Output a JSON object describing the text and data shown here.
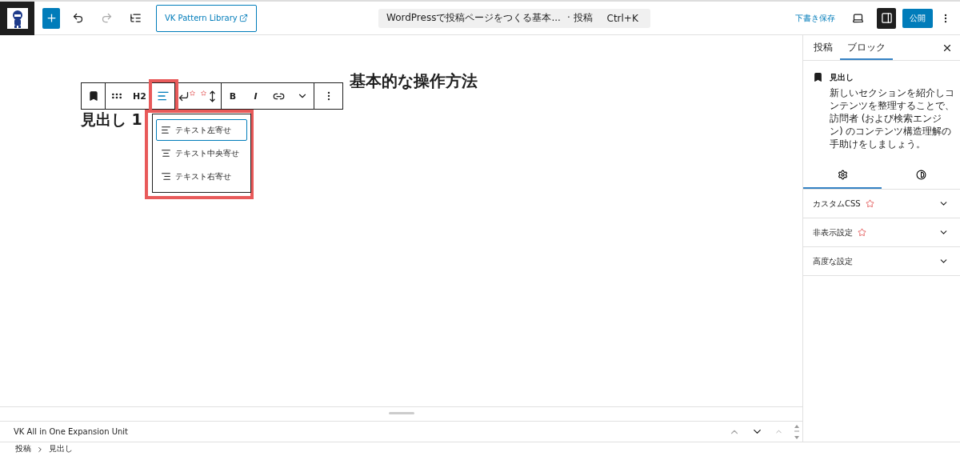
{
  "header": {
    "pattern_button": "VK Pattern Library",
    "command_bar": {
      "title": "WordPressで投稿ページをつくる基本...",
      "type": "· 投稿",
      "shortcut": "Ctrl+K"
    },
    "save_draft": "下書き保存",
    "settings_on": true,
    "publish": "公開"
  },
  "editor": {
    "post_title": "基本的な操作方法",
    "heading": "見出し 1",
    "toolbar": [
      {
        "kind": "bookmark",
        "highlighted": false
      },
      {
        "kind": "drag",
        "highlighted": false
      },
      {
        "kind": "text",
        "label": "H2",
        "highlighted": false
      },
      {
        "kind": "align",
        "highlighted": true
      },
      {
        "kind": "break",
        "highlighted": false
      },
      {
        "kind": "height",
        "highlighted": false
      },
      {
        "kind": "text",
        "label": "B",
        "highlighted": false
      },
      {
        "kind": "italic",
        "label": "I",
        "highlighted": false
      },
      {
        "kind": "link",
        "highlighted": false
      },
      {
        "kind": "chevron",
        "highlighted": false
      },
      {
        "kind": "more",
        "highlighted": false
      }
    ],
    "align_menu": {
      "highlighted": true,
      "items": [
        {
          "label": "テキスト左寄せ",
          "kind": "left",
          "selected": true
        },
        {
          "label": "テキスト中央寄せ",
          "kind": "center",
          "selected": false
        },
        {
          "label": "テキスト右寄せ",
          "kind": "right",
          "selected": false
        }
      ]
    }
  },
  "meta_panel": {
    "title": "VK All in One Expansion Unit"
  },
  "breadcrumb": [
    "投稿",
    "見出し"
  ],
  "sidebar": {
    "tabs": [
      {
        "label": "投稿",
        "selected": false
      },
      {
        "label": "ブロック",
        "selected": true
      }
    ],
    "block": {
      "name": "見出し",
      "description": "新しいセクションを紹介しコンテンツを整理することで、訪問者 (および検索エンジン) のコンテンツ構造理解の手助けをしましょう。"
    },
    "sub_tabs": [
      {
        "kind": "settings",
        "selected": true
      },
      {
        "kind": "styles",
        "selected": false
      }
    ],
    "panels": [
      {
        "label": "カスタムCSS",
        "vk_badge": true,
        "expanded": false
      },
      {
        "label": "非表示設定",
        "vk_badge": true,
        "expanded": false
      },
      {
        "label": "高度な設定",
        "vk_badge": false,
        "expanded": false
      }
    ]
  }
}
